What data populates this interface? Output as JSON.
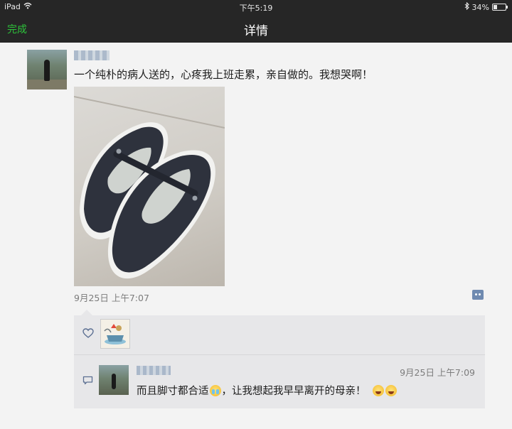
{
  "status_bar": {
    "device": "iPad",
    "time": "下午5:19",
    "battery": "34%",
    "battery_level": 0.34
  },
  "nav": {
    "done": "完成",
    "title": "详情"
  },
  "post": {
    "text": "一个纯朴的病人送的，心疼我上班走累，亲自做的。我想哭啊！",
    "timestamp": "9月25日 上午7:07"
  },
  "reply": {
    "time": "9月25日 上午7:09",
    "text_part1": "而且脚寸都合适",
    "text_part2": "，让我想起我早早离开的母亲！"
  },
  "colors": {
    "bar_bg": "#262626",
    "done_green": "#2dc33b",
    "comment_blue": "#6f8ab0",
    "box_bg": "#e7e7e9"
  },
  "icons": [
    "wifi-icon",
    "bluetooth-icon",
    "battery-icon",
    "comment-icon",
    "heart-icon",
    "speech-bubble-icon"
  ]
}
